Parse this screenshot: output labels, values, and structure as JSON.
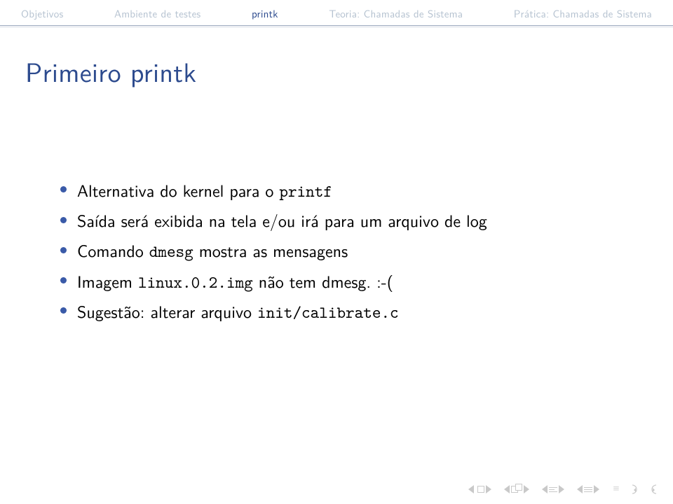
{
  "nav": {
    "items": [
      {
        "label": "Objetivos",
        "active": false
      },
      {
        "label": "Ambiente de testes",
        "active": false
      },
      {
        "label": "printk",
        "active": true
      },
      {
        "label": "Teoria: Chamadas de Sistema",
        "active": false
      },
      {
        "label": "Prática: Chamadas de Sistema",
        "active": false
      }
    ]
  },
  "title": "Primeiro printk",
  "bullets": [
    {
      "pre": "Alternativa do kernel para o ",
      "tt": "printf",
      "post": ""
    },
    {
      "pre": "Saída será exibida na tela e/ou irá para um arquivo de log",
      "tt": "",
      "post": ""
    },
    {
      "pre": "Comando ",
      "tt": "dmesg",
      "post": " mostra as mensagens"
    },
    {
      "pre": "Imagem ",
      "tt": "linux.0.2.img",
      "post": " não tem dmesg. :-("
    },
    {
      "pre": "Sugestão: alterar arquivo ",
      "tt": "init/calibrate.c",
      "post": ""
    }
  ]
}
